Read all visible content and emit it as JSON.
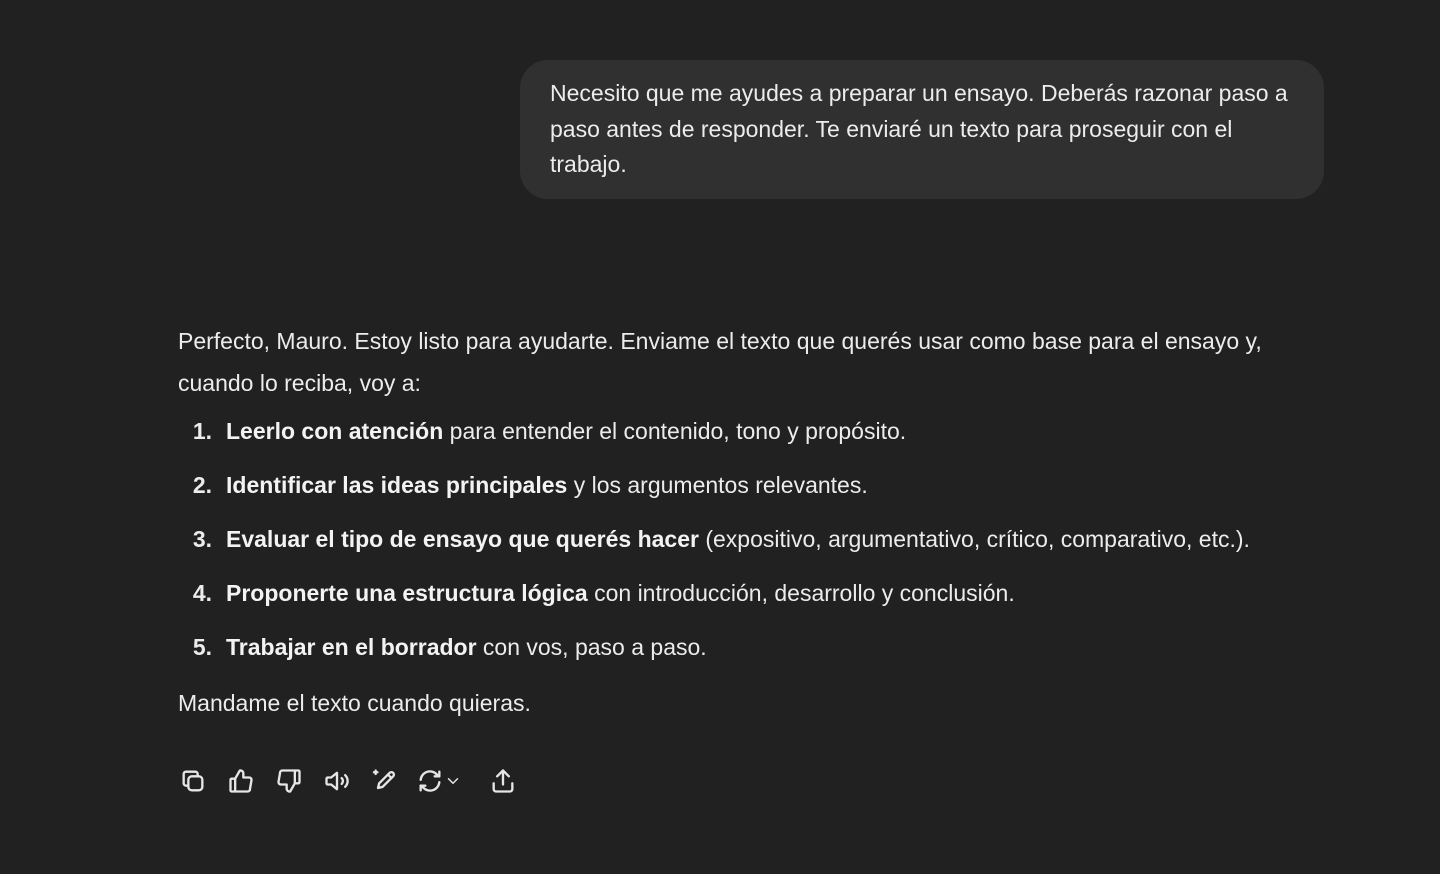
{
  "user_message": {
    "text": "Necesito que me ayudes a preparar un ensayo. Deberás razonar paso a paso antes de responder. Te enviaré un texto para proseguir con el trabajo."
  },
  "assistant_message": {
    "intro": "Perfecto, Mauro. Estoy listo para ayudarte. Enviame el texto que querés usar como base para el ensayo y, cuando lo reciba, voy a:",
    "steps": [
      {
        "num": "1.",
        "bold": "Leerlo con atención",
        "rest": " para entender el contenido, tono y propósito."
      },
      {
        "num": "2.",
        "bold": "Identificar las ideas principales",
        "rest": " y los argumentos relevantes."
      },
      {
        "num": "3.",
        "bold": "Evaluar el tipo de ensayo que querés hacer",
        "rest": " (expositivo, argumentativo, crítico, comparativo, etc.)."
      },
      {
        "num": "4.",
        "bold": "Proponerte una estructura lógica",
        "rest": " con introducción, desarrollo y conclusión."
      },
      {
        "num": "5.",
        "bold": "Trabajar en el borrador",
        "rest": " con vos, paso a paso."
      }
    ],
    "outro": "Mandame el texto cuando quieras."
  },
  "actions": [
    {
      "icon": "copy-icon"
    },
    {
      "icon": "thumbs-up-icon"
    },
    {
      "icon": "thumbs-down-icon"
    },
    {
      "icon": "read-aloud-icon"
    },
    {
      "icon": "edit-icon"
    },
    {
      "icon": "regenerate-icon"
    },
    {
      "icon": "share-icon"
    }
  ],
  "colors": {
    "background": "#212121",
    "user_bubble": "#303030",
    "text": "#ececec"
  }
}
